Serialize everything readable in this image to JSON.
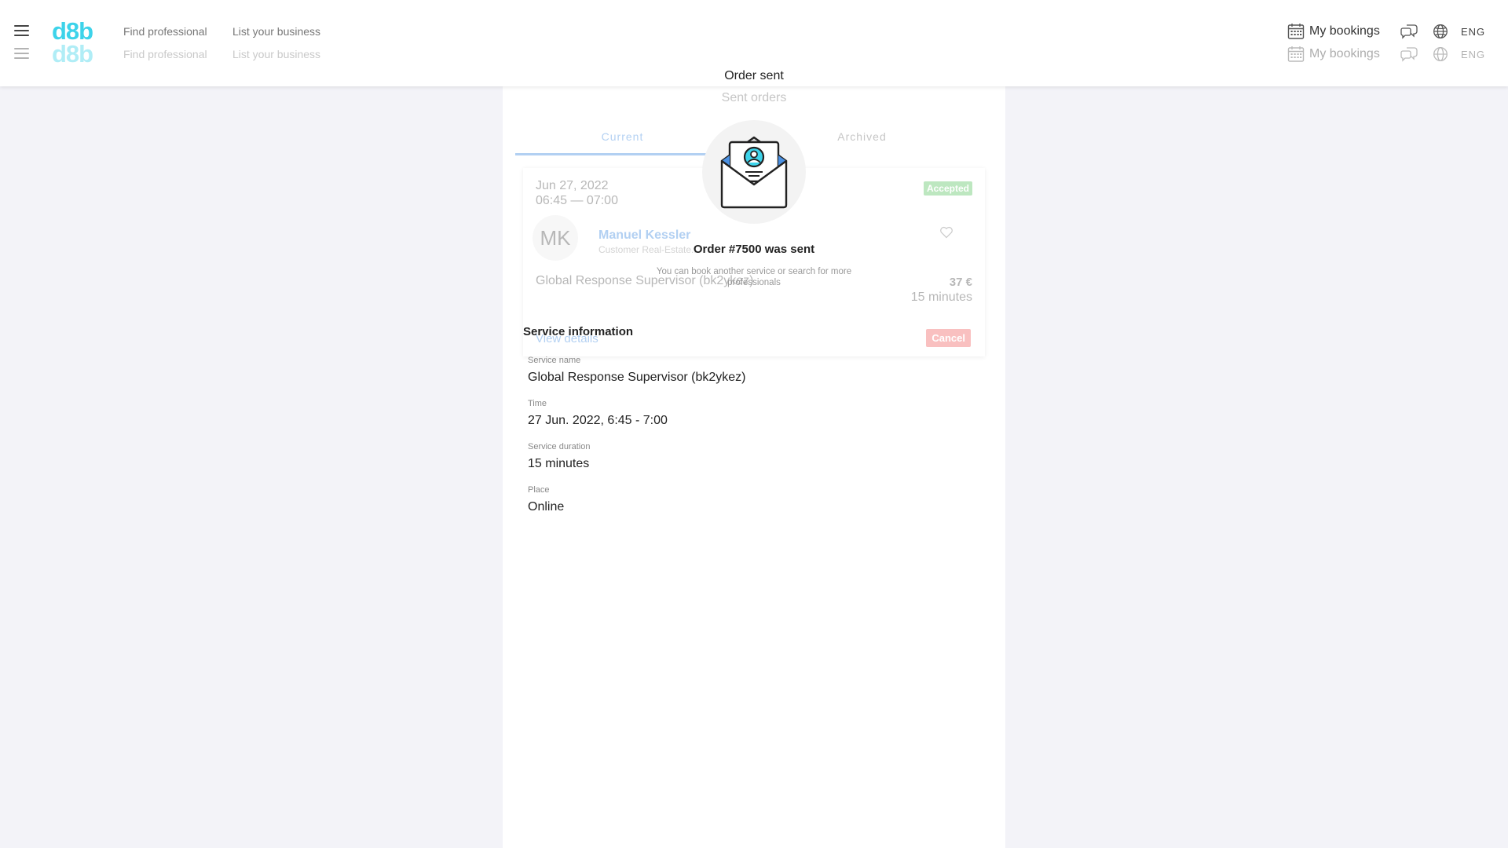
{
  "header": {
    "logo": "d8b",
    "nav": {
      "find_professional": "Find professional",
      "list_business": "List your business"
    },
    "my_bookings": "My bookings",
    "language": "ENG"
  },
  "page": {
    "title": "Order sent"
  },
  "background": {
    "sent_orders_title": "Sent orders",
    "tabs": {
      "current": "Current",
      "archived": "Archived"
    },
    "order": {
      "date": "Jun 27, 2022",
      "time": "06:45 — 07:00",
      "status": "Accepted",
      "avatar_initials": "MK",
      "name": "Manuel Kessler",
      "role": "Customer Real-Estate...",
      "service": "Global Response Supervisor (bk2ykez)",
      "price": "37 €",
      "duration": "15 minutes",
      "details_link": "View details",
      "cancel_button": "Cancel"
    }
  },
  "confirmation": {
    "icon": "envelope-icon",
    "heading": "Order #7500 was sent",
    "subtext": "You can book another service or search for more professionals"
  },
  "service_info": {
    "title": "Service information",
    "fields": [
      {
        "label": "Service name",
        "value": "Global Response Supervisor (bk2ykez)"
      },
      {
        "label": "Time",
        "value": "27 Jun. 2022, 6:45 - 7:00"
      },
      {
        "label": "Service duration",
        "value": "15 minutes"
      },
      {
        "label": "Place",
        "value": "Online"
      }
    ]
  },
  "colors": {
    "brand": "#3dd3ea",
    "link": "#4a90e2",
    "accepted": "#63c76a",
    "cancel": "#f36b6b",
    "background": "#f3f3f8"
  }
}
